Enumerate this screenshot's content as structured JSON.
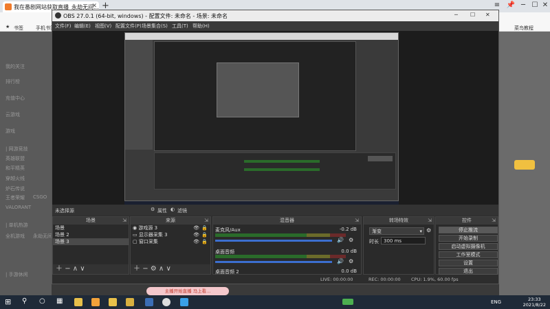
{
  "browser": {
    "tab_title": "我在番剧网站获取直播_永劫无间...",
    "tab_close": "✕",
    "new_tab": "+",
    "bookmarks": [
      "书签",
      "手机书签"
    ],
    "right_bookmark": "菜鸟教程"
  },
  "page": {
    "sidebar_items": [
      "我的关注",
      "排行榜",
      "充值中心",
      "云游戏",
      "游戏",
      "| 网游竞技",
      "英雄联盟",
      "和平精英",
      "穿越火线",
      "炉石传说",
      "王者荣耀",
      "CSGO",
      "VALORANT",
      "| 单机热游",
      "全机游戏",
      "永劫无间",
      "| 手游休闲"
    ],
    "banner_text": "主播开始直播 马上看..."
  },
  "obs": {
    "title": "OBS 27.0.1 (64-bit, windows) - 配置文件: 未命名 - 场景: 未命名",
    "menu": [
      "文件(F)",
      "编辑(E)",
      "视图(V)",
      "配置文件(P)",
      "场景集合(S)",
      "工具(T)",
      "帮助(H)"
    ],
    "no_source": "未选择源",
    "props_label": "属性",
    "filter_label": "滤镜",
    "scenes": {
      "title": "场景",
      "items": [
        "场景",
        "场景 2",
        "场景 3"
      ],
      "selected": 2
    },
    "sources": {
      "title": "来源",
      "items": [
        "游戏源 3",
        "显示器采集 3",
        "窗口采集"
      ]
    },
    "mixer": {
      "title": "混音器",
      "tracks": [
        {
          "name": "麦克风/Aux",
          "level": "-0.2 dB"
        },
        {
          "name": "桌面音频",
          "level": "0.0 dB"
        },
        {
          "name": "桌面音频 2",
          "level": "0.0 dB"
        }
      ]
    },
    "transitions": {
      "title": "转场特效",
      "type": "渐变",
      "duration_label": "时长",
      "duration": "300 ms"
    },
    "controls": {
      "title": "控件",
      "buttons": [
        "停止推流",
        "开始录制",
        "启动虚拟摄像机",
        "工作室模式",
        "设置",
        "退出"
      ],
      "active": 0
    },
    "status": {
      "live": "LIVE: 00:00:00",
      "rec": "REC: 00:00:00",
      "cpu": "CPU: 1.9%, 60.00 fps"
    }
  },
  "taskbar": {
    "lang": "ENG",
    "time": "23:33",
    "date": "2021/8/22"
  },
  "colors": {
    "accent": "#3c6fd0",
    "meter_green": "#2a6b2a",
    "taskbar": "#1f2a38"
  }
}
